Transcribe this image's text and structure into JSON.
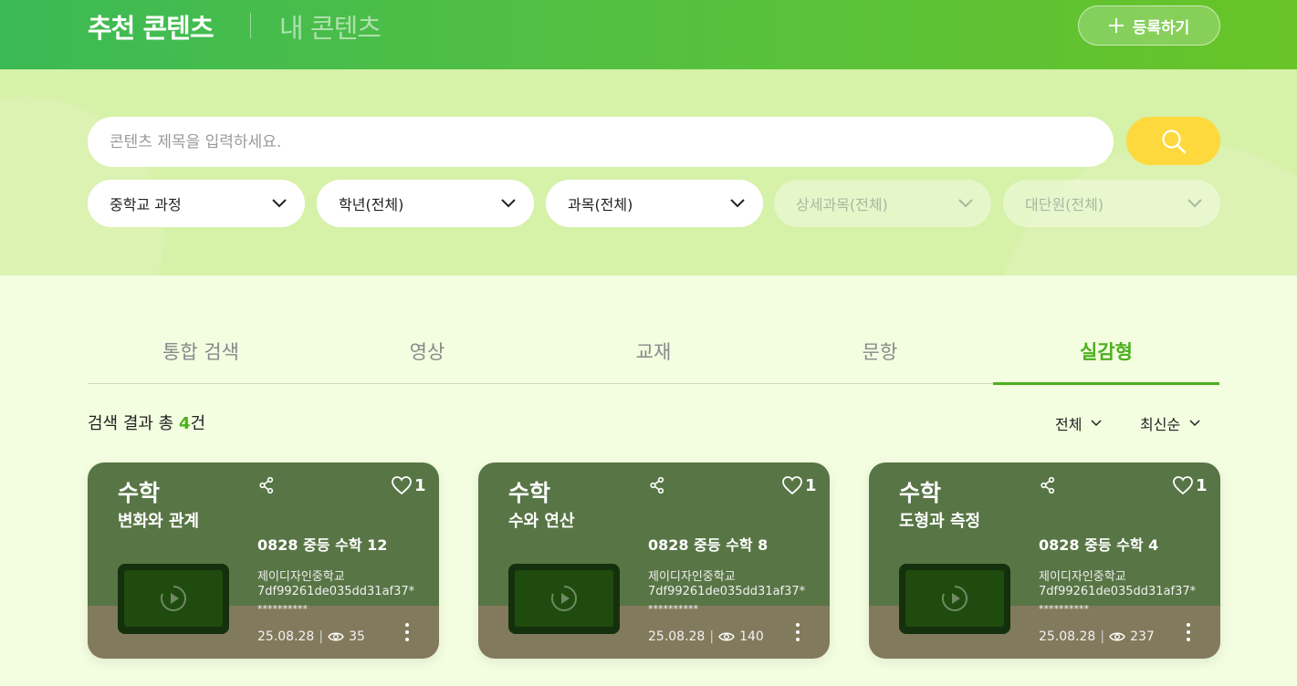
{
  "header": {
    "nav_active": "추천 콘텐츠",
    "nav_inactive": "내 콘텐츠",
    "register_label": "등록하기"
  },
  "search": {
    "placeholder": "콘텐츠 제목을 입력하세요.",
    "value": ""
  },
  "filters": [
    {
      "label": "중학교 과정",
      "enabled": true
    },
    {
      "label": "학년(전체)",
      "enabled": true
    },
    {
      "label": "과목(전체)",
      "enabled": true
    },
    {
      "label": "상세과목(전체)",
      "enabled": false
    },
    {
      "label": "대단원(전체)",
      "enabled": false
    }
  ],
  "tabs": [
    {
      "label": "통합 검색",
      "active": false
    },
    {
      "label": "영상",
      "active": false
    },
    {
      "label": "교재",
      "active": false
    },
    {
      "label": "문항",
      "active": false
    },
    {
      "label": "실감형",
      "active": true
    }
  ],
  "results": {
    "prefix": "검색 결과 총 ",
    "count": "4",
    "suffix": "건",
    "filter_label": "전체",
    "sort_label": "최신순"
  },
  "cards": [
    {
      "subject": "수학",
      "unit": "변화와 관계",
      "likes": "1",
      "title": "0828 중등 수학 12",
      "school": "제이디자인중학교",
      "code": "7df99261de035dd31af37*",
      "masked": "**********",
      "date": "25.08.28",
      "views": "35"
    },
    {
      "subject": "수학",
      "unit": "수와 연산",
      "likes": "1",
      "title": "0828 중등 수학 8",
      "school": "제이디자인중학교",
      "code": "7df99261de035dd31af37*",
      "masked": "**********",
      "date": "25.08.28",
      "views": "140"
    },
    {
      "subject": "수학",
      "unit": "도형과 측정",
      "likes": "1",
      "title": "0828 중등 수학 4",
      "school": "제이디자인중학교",
      "code": "7df99261de035dd31af37*",
      "masked": "**********",
      "date": "25.08.28",
      "views": "237"
    }
  ],
  "colors": {
    "header_green": "#55c040",
    "search_bg": "#d6f1a8",
    "accent": "#4caf1e",
    "search_button": "#fed93e",
    "card_top": "#587545",
    "card_bottom": "#827a5c"
  },
  "icons": [
    "plus-icon",
    "search-icon",
    "chevron-down-icon",
    "share-icon",
    "heart-icon",
    "play-icon",
    "eye-icon",
    "more-vertical-icon"
  ]
}
